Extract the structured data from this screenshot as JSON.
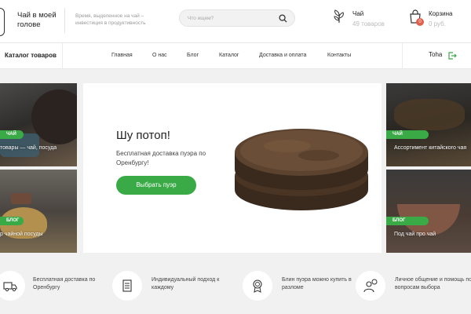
{
  "header": {
    "logo_text": "Чай в моей голове",
    "tagline": "Время, выделенное на чай – инвестиция в продуктивность",
    "search_placeholder": "Что ищем?",
    "tea": {
      "label": "Чай",
      "count": "49 товаров"
    },
    "cart": {
      "label": "Корзина",
      "sum": "0 руб.",
      "badge": "0"
    }
  },
  "nav": {
    "catalog": "Каталог товаров",
    "items": [
      "Главная",
      "О нас",
      "Блог",
      "Каталог",
      "Доставка и оплата",
      "Контакты"
    ],
    "user": "Toha"
  },
  "tiles": {
    "left_top": {
      "badge": "ЧАЙ",
      "caption": "товары — чай, посуда"
    },
    "left_bottom": {
      "badge": "БЛОГ",
      "caption": "р чайной посуды"
    },
    "right_top": {
      "badge": "ЧАЙ",
      "caption": "Ассортимент китайского чая"
    },
    "right_bottom": {
      "badge": "БЛОГ",
      "caption": "Под чай про чай"
    }
  },
  "hero": {
    "title": "Шу потоп!",
    "text": "Бесплатная доставка пуэра по Оренбургу!",
    "button": "Выбрать пуэр"
  },
  "features": [
    {
      "icon": "truck-icon",
      "text": "Бесплатная доставка по Оренбургу"
    },
    {
      "icon": "checklist-icon",
      "text": "Индивидуальный подход к каждому"
    },
    {
      "icon": "medal-icon",
      "text": "Блин пуэра можно купить в разломе"
    },
    {
      "icon": "support-icon",
      "text": "Личное общение и помощь по вопросам выбора"
    }
  ],
  "colors": {
    "accent": "#3aaa47",
    "badge": "#e0604b",
    "background": "#f1f1f1"
  }
}
